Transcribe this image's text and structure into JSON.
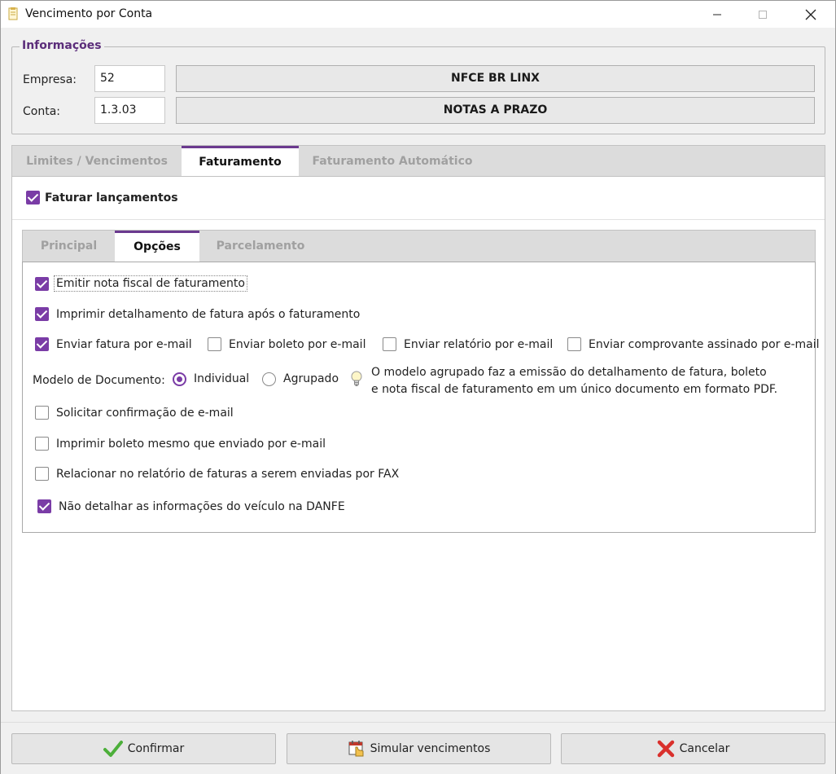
{
  "window": {
    "title": "Vencimento por Conta",
    "controls": [
      "minimize-icon",
      "maximize-icon",
      "close-icon"
    ]
  },
  "info": {
    "legend": "Informações",
    "empresa_label": "Empresa:",
    "empresa_code": "52",
    "empresa_name": "NFCE BR LINX",
    "conta_label": "Conta:",
    "conta_code": "1.3.03",
    "conta_name": "NOTAS A PRAZO"
  },
  "main_tabs": [
    {
      "label": "Limites / Vencimentos",
      "active": false
    },
    {
      "label": "Faturamento",
      "active": true
    },
    {
      "label": "Faturamento Automático",
      "active": false
    }
  ],
  "faturar": {
    "label": "Faturar lançamentos",
    "checked": true
  },
  "sub_tabs": [
    {
      "label": "Principal",
      "active": false
    },
    {
      "label": "Opções",
      "active": true
    },
    {
      "label": "Parcelamento",
      "active": false
    }
  ],
  "options": {
    "emitir_nf": {
      "label": "Emitir nota fiscal de faturamento",
      "checked": true
    },
    "imprimir_detalhamento": {
      "label": "Imprimir detalhamento de fatura após o faturamento",
      "checked": true
    },
    "enviar_fatura": {
      "label": "Enviar fatura por e-mail",
      "checked": true
    },
    "enviar_boleto": {
      "label": "Enviar boleto por e-mail",
      "checked": false
    },
    "enviar_relatorio": {
      "label": "Enviar relatório por e-mail",
      "checked": false
    },
    "enviar_comprovante": {
      "label": "Enviar comprovante assinado por e-mail",
      "checked": false
    },
    "modelo_label": "Modelo de Documento:",
    "modelo_individual": {
      "label": "Individual",
      "selected": true
    },
    "modelo_agrupado": {
      "label": "Agrupado",
      "selected": false
    },
    "hint_line1": "O modelo agrupado faz a emissão do detalhamento de fatura, boleto",
    "hint_line2": "e nota fiscal de faturamento em um único documento em formato PDF.",
    "solicitar_confirmacao": {
      "label": "Solicitar confirmação de e-mail",
      "checked": false
    },
    "imprimir_boleto": {
      "label": "Imprimir boleto mesmo que enviado por e-mail",
      "checked": false
    },
    "relacionar_fax": {
      "label": "Relacionar no relatório de faturas a serem enviadas por FAX",
      "checked": false
    },
    "nao_detalhar_veiculo": {
      "label": "Não detalhar as informações do veículo na DANFE",
      "checked": true
    }
  },
  "buttons": {
    "confirmar": "Confirmar",
    "simular": "Simular vencimentos",
    "cancelar": "Cancelar"
  },
  "colors": {
    "accent": "#7a3ca6",
    "legend": "#5b2d7a",
    "confirm_icon": "#4caf3a",
    "cancel_icon": "#d9302c"
  }
}
